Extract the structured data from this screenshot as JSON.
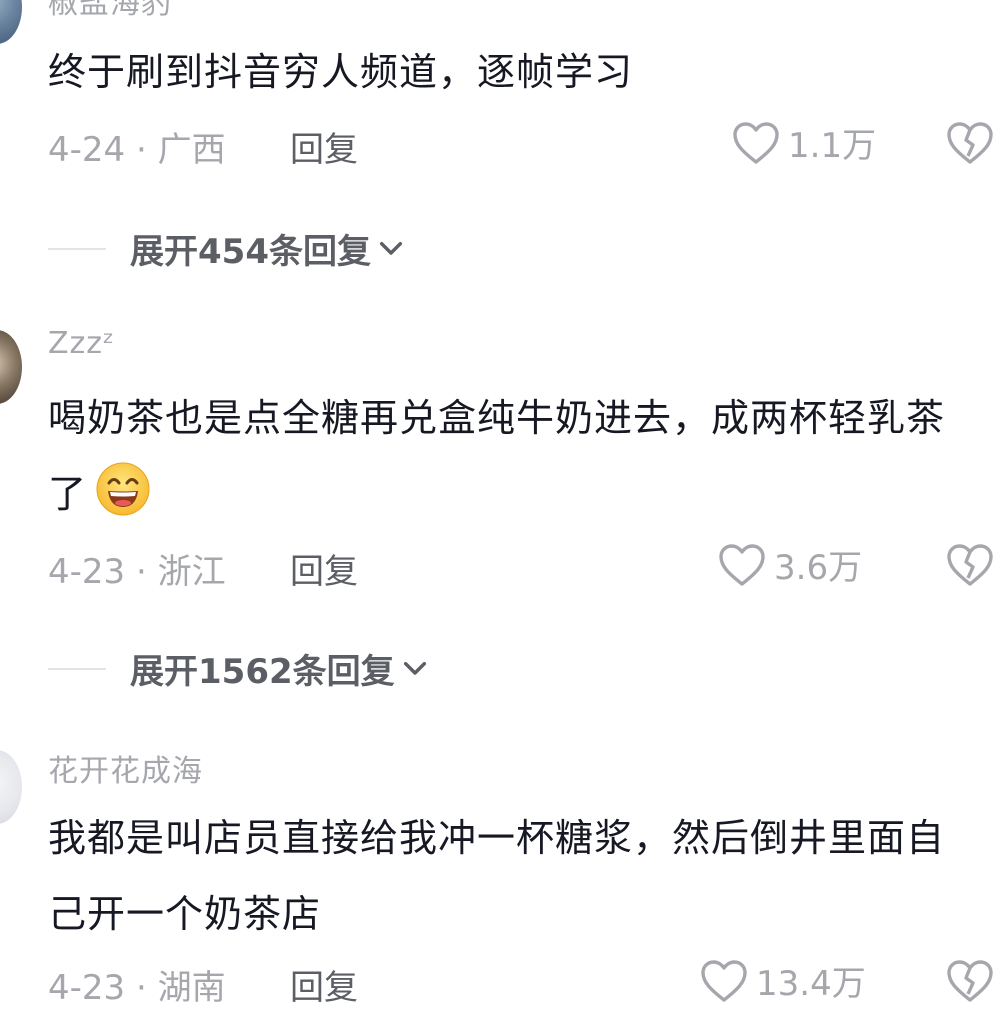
{
  "comments": [
    {
      "username": "椒盐海豹",
      "text": "终于刷到抖音穷人频道，逐帧学习",
      "date_location": "4-24 · 广西",
      "reply_label": "回复",
      "likes": "1.1万",
      "expand_label": "展开454条回复"
    },
    {
      "username": "Zzzᶻ",
      "text": "喝奶茶也是点全糖再兑盒纯牛奶进去，成两杯轻乳茶了",
      "emoji": "grinning-face-icon",
      "date_location": "4-23 · 浙江",
      "reply_label": "回复",
      "likes": "3.6万",
      "expand_label": "展开1562条回复"
    },
    {
      "username": "花开花成海",
      "text": "我都是叫店员直接给我冲一杯糖浆，然后倒井里面自己开一个奶茶店",
      "date_location": "4-23 · 湖南",
      "reply_label": "回复",
      "likes": "13.4万"
    }
  ],
  "colors": {
    "text_primary": "#161823",
    "text_secondary": "#a5a7ad",
    "action_text": "#5c5e66",
    "background": "#ffffff"
  }
}
